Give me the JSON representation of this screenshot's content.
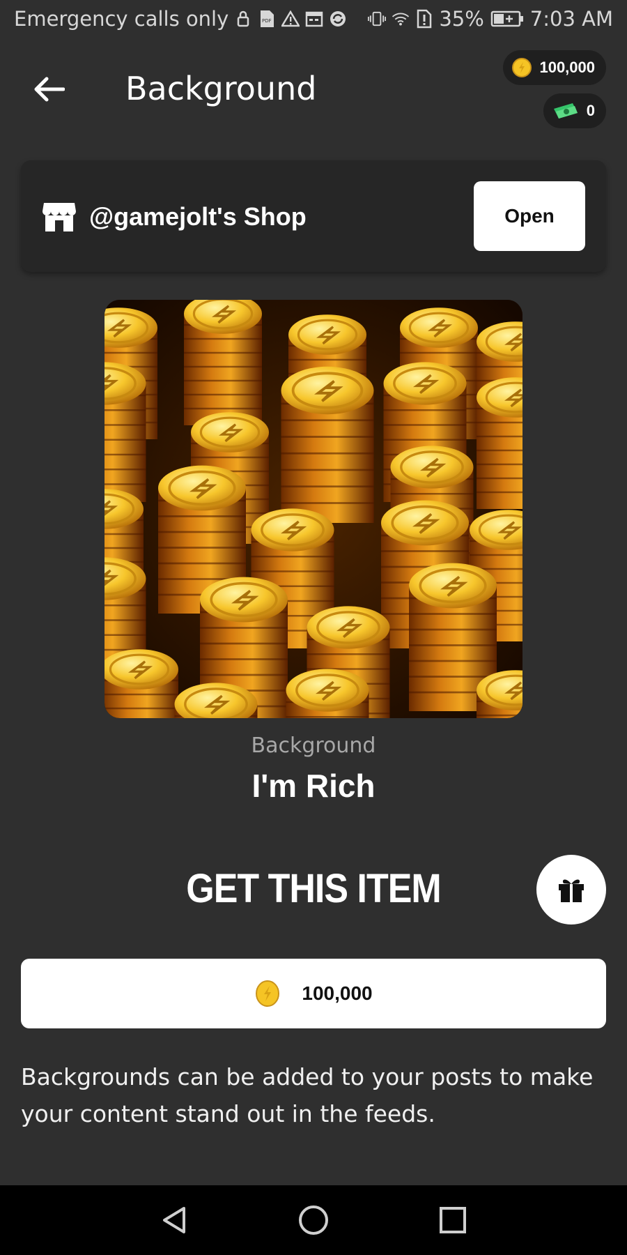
{
  "status_bar": {
    "left_text": "Emergency calls only",
    "battery": "35%",
    "time": "7:03 AM",
    "icons": [
      "lock-icon",
      "pdf-icon",
      "warning-icon",
      "calendar-icon",
      "sync-icon",
      "vibrate-icon",
      "wifi-icon",
      "alert-icon",
      "battery-icon"
    ]
  },
  "header": {
    "title": "Background",
    "coins": "100,000",
    "cash": "0"
  },
  "shop": {
    "name": "@gamejolt's Shop",
    "open_label": "Open"
  },
  "item": {
    "type": "Background",
    "name": "I'm Rich",
    "image": "gold-coins-stack"
  },
  "purchase": {
    "title": "GET THIS ITEM",
    "price": "100,000"
  },
  "description": "Backgrounds can be added to your posts to make your content stand out in the feeds.",
  "nav": {
    "icons": [
      "back-triangle-icon",
      "home-circle-icon",
      "recents-square-icon"
    ]
  },
  "colors": {
    "background": "#2f2f2f",
    "card": "#262626",
    "coin_gold": "#f5c425",
    "cash_green": "#35c46a"
  }
}
